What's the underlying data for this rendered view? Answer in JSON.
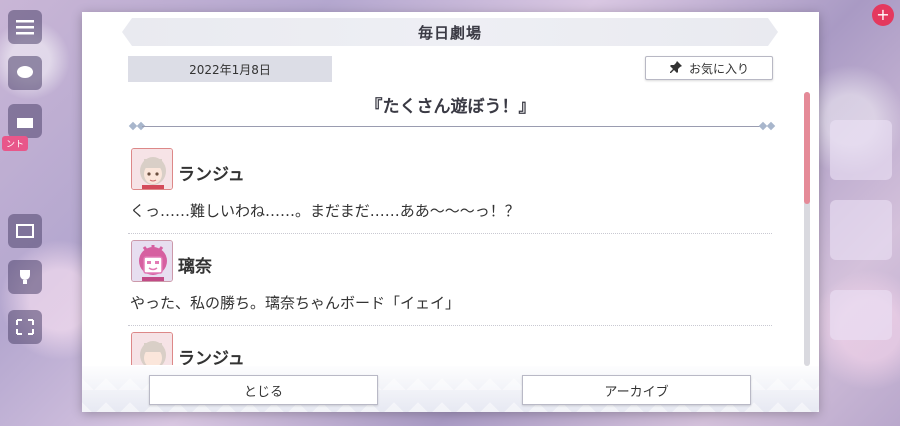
{
  "dialog": {
    "title": "毎日劇場",
    "date": "2022年1月8日",
    "favorite_label": "お気に入り",
    "episode_title": "『たくさん遊ぼう！』",
    "messages": [
      {
        "speaker": "ランジュ",
        "text": "くっ……難しいわね……。まだまだ……ああ～～～っ！？"
      },
      {
        "speaker": "璃奈",
        "text": "やった、私の勝ち。璃奈ちゃんボード「イェイ」"
      },
      {
        "speaker": "ランジュ",
        "text": ""
      }
    ],
    "close_label": "とじる",
    "archive_label": "アーカイブ"
  },
  "background": {
    "side_badge": "ント"
  },
  "colors": {
    "scroll_thumb": "#e58a98",
    "title_bar": "#e9eaf0",
    "date_box": "#dcdde6"
  },
  "icons": {
    "favorite": "pin-icon",
    "menu": "hamburger-icon"
  }
}
